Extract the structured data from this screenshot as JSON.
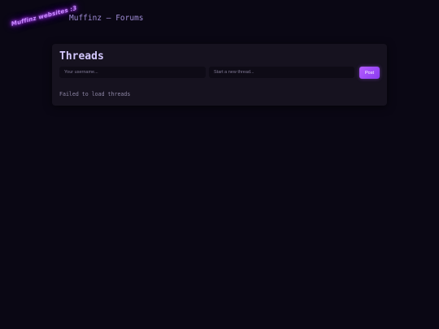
{
  "header": {
    "logo_text": "Muffinz websites :3",
    "site_title": "Muffinz — Forums"
  },
  "threads_panel": {
    "title": "Threads",
    "username_placeholder": "Your username...",
    "thread_placeholder": "Start a new thread...",
    "post_label": "Post",
    "status_message": "Failed to load threads"
  },
  "colors": {
    "background": "#0a0714",
    "card": "#16121f",
    "accent": "#a855f7",
    "logo_glow": "#b44cff",
    "title_text": "#d4c8ff"
  }
}
